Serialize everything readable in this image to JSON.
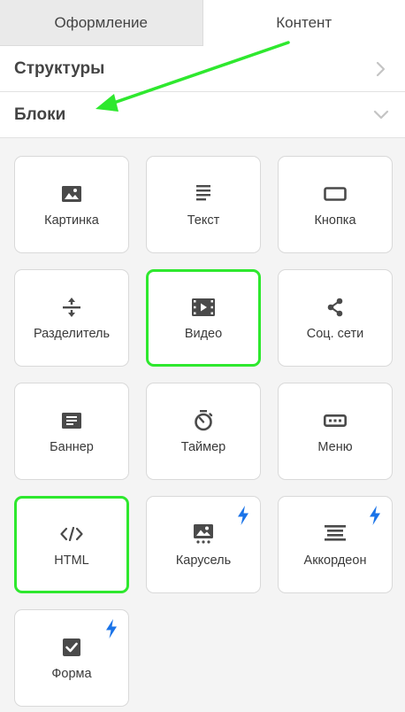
{
  "tabs": [
    {
      "label": "Оформление",
      "active": false
    },
    {
      "label": "Контент",
      "active": true
    }
  ],
  "sections": [
    {
      "title": "Структуры",
      "expanded": false
    },
    {
      "title": "Блоки",
      "expanded": true
    }
  ],
  "blocks": [
    {
      "label": "Картинка",
      "icon": "image-icon",
      "highlighted": false,
      "amp": false
    },
    {
      "label": "Текст",
      "icon": "text-lines-icon",
      "highlighted": false,
      "amp": false
    },
    {
      "label": "Кнопка",
      "icon": "button-icon",
      "highlighted": false,
      "amp": false
    },
    {
      "label": "Разделитель",
      "icon": "divider-icon",
      "highlighted": false,
      "amp": false
    },
    {
      "label": "Видео",
      "icon": "video-icon",
      "highlighted": true,
      "amp": false
    },
    {
      "label": "Соц. сети",
      "icon": "share-icon",
      "highlighted": false,
      "amp": false
    },
    {
      "label": "Баннер",
      "icon": "banner-icon",
      "highlighted": false,
      "amp": false
    },
    {
      "label": "Таймер",
      "icon": "timer-icon",
      "highlighted": false,
      "amp": false
    },
    {
      "label": "Меню",
      "icon": "menu-icon",
      "highlighted": false,
      "amp": false
    },
    {
      "label": "HTML",
      "icon": "code-icon",
      "highlighted": true,
      "amp": false
    },
    {
      "label": "Карусель",
      "icon": "carousel-icon",
      "highlighted": false,
      "amp": true
    },
    {
      "label": "Аккордеон",
      "icon": "accordion-icon",
      "highlighted": false,
      "amp": true
    },
    {
      "label": "Форма",
      "icon": "checkbox-icon",
      "highlighted": false,
      "amp": true
    }
  ],
  "colors": {
    "highlight": "#2ee82e",
    "arrow": "#2ee82e",
    "bolt": "#1a73e8",
    "icon": "#4a4a4a"
  }
}
